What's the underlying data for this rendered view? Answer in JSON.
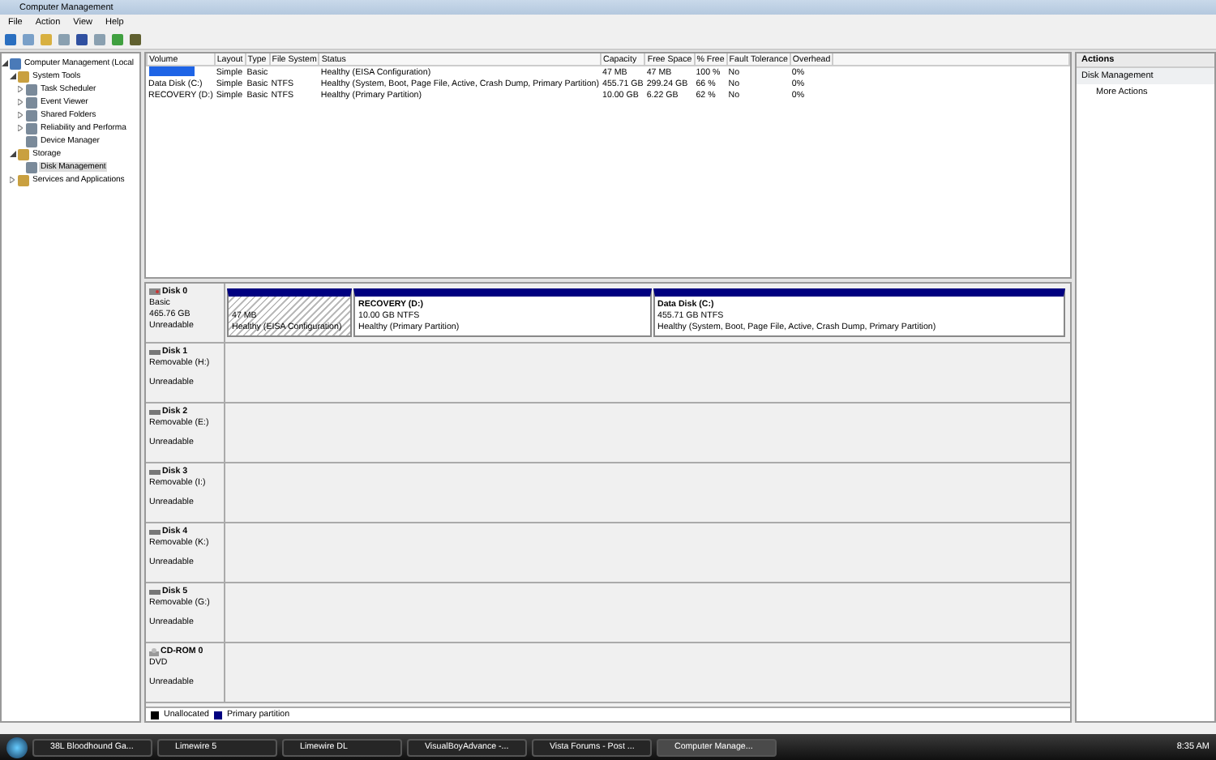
{
  "window": {
    "title": "Computer Management"
  },
  "menu": [
    "File",
    "Action",
    "View",
    "Help"
  ],
  "tree": [
    {
      "label": "Computer Management (Local",
      "selected": false,
      "expanded": true,
      "children": [
        {
          "label": "System Tools",
          "selected": false,
          "expanded": true,
          "children": [
            {
              "label": "Task Scheduler",
              "selected": false,
              "expanded": false
            },
            {
              "label": "Event Viewer",
              "selected": false,
              "expanded": false
            },
            {
              "label": "Shared Folders",
              "selected": false,
              "expanded": false
            },
            {
              "label": "Reliability and Performa",
              "selected": false,
              "expanded": false
            },
            {
              "label": "Device Manager",
              "selected": false
            }
          ]
        },
        {
          "label": "Storage",
          "selected": false,
          "expanded": true,
          "children": [
            {
              "label": "Disk Management",
              "selected": true
            }
          ]
        },
        {
          "label": "Services and Applications",
          "selected": false,
          "expanded": false
        }
      ]
    }
  ],
  "volume_table": {
    "columns": [
      "Volume",
      "Layout",
      "Type",
      "File System",
      "Status",
      "Capacity",
      "Free Space",
      "% Free",
      "Fault Tolerance",
      "Overhead"
    ],
    "rows": [
      {
        "redacted": true,
        "cells": [
          "",
          "Simple",
          "Basic",
          "",
          "Healthy (EISA Configuration)",
          "47 MB",
          "47 MB",
          "100 %",
          "No",
          "0%"
        ]
      },
      {
        "redacted": false,
        "cells": [
          "Data Disk (C:)",
          "Simple",
          "Basic",
          "NTFS",
          "Healthy (System, Boot, Page File, Active, Crash Dump, Primary Partition)",
          "455.71 GB",
          "299.24 GB",
          "66 %",
          "No",
          "0%"
        ]
      },
      {
        "redacted": false,
        "cells": [
          "RECOVERY (D:)",
          "Simple",
          "Basic",
          "NTFS",
          "Healthy (Primary Partition)",
          "10.00 GB",
          "6.22 GB",
          "62 %",
          "No",
          "0%"
        ]
      }
    ]
  },
  "disks": [
    {
      "kind": "hdd",
      "name": "Disk 0",
      "type": "Basic",
      "size": "465.76 GB",
      "state": "Unreadable",
      "partitions": [
        {
          "kind": "oem",
          "size": "47 MB",
          "status": "Healthy (EISA Configuration)"
        },
        {
          "kind": "primary",
          "name": "RECOVERY  (D:)",
          "size": "10.00 GB NTFS",
          "status": "Healthy (Primary Partition)"
        },
        {
          "kind": "primary",
          "name": "Data Disk  (C:)",
          "size": "455.71 GB NTFS",
          "status": "Healthy (System, Boot, Page File, Active, Crash Dump, Primary Partition)"
        }
      ]
    },
    {
      "kind": "removable",
      "name": "Disk 1",
      "type": "Removable (H:)",
      "state": "Unreadable"
    },
    {
      "kind": "removable",
      "name": "Disk 2",
      "type": "Removable (E:)",
      "state": "Unreadable"
    },
    {
      "kind": "removable",
      "name": "Disk 3",
      "type": "Removable (I:)",
      "state": "Unreadable"
    },
    {
      "kind": "removable",
      "name": "Disk 4",
      "type": "Removable (K:)",
      "state": "Unreadable"
    },
    {
      "kind": "removable",
      "name": "Disk 5",
      "type": "Removable (G:)",
      "state": "Unreadable"
    },
    {
      "kind": "cdrom",
      "name": "CD-ROM 0",
      "type": "DVD",
      "state": "Unreadable"
    }
  ],
  "legend": [
    {
      "label": "Unallocated",
      "color": "#000000"
    },
    {
      "label": "Primary partition",
      "color": "#000080"
    }
  ],
  "actions": {
    "title": "Actions",
    "section": "Disk Management",
    "items": [
      "More Actions"
    ]
  },
  "taskbar": {
    "items": [
      {
        "label": "38L Bloodhound Ga...",
        "selected": false
      },
      {
        "label": "Limewire 5",
        "selected": false
      },
      {
        "label": "Limewire DL",
        "selected": false
      },
      {
        "label": "VisualBoyAdvance -...",
        "selected": false
      },
      {
        "label": "Vista Forums - Post ...",
        "selected": false
      },
      {
        "label": "Computer Manage...",
        "selected": true
      }
    ],
    "clock": "8:35 AM"
  }
}
